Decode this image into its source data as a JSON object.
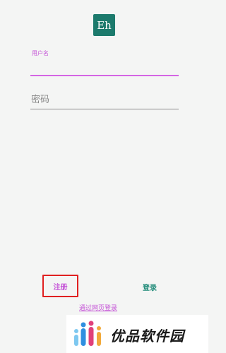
{
  "app": {
    "logo_text": "Eh",
    "logo_color": "#1c7a6c"
  },
  "login_form": {
    "username_label": "用户名",
    "username_value": "",
    "password_placeholder": "密码",
    "password_value": ""
  },
  "actions": {
    "register_label": "注册",
    "login_label": "登录",
    "web_login_label": "通过网页登录"
  },
  "watermark": {
    "text": "优品软件园",
    "icon": "people-figures-logo"
  },
  "colors": {
    "accent": "#c452d6",
    "login_button": "#1f8a78",
    "highlight_box": "#e02020",
    "background": "#f4f5f4"
  }
}
